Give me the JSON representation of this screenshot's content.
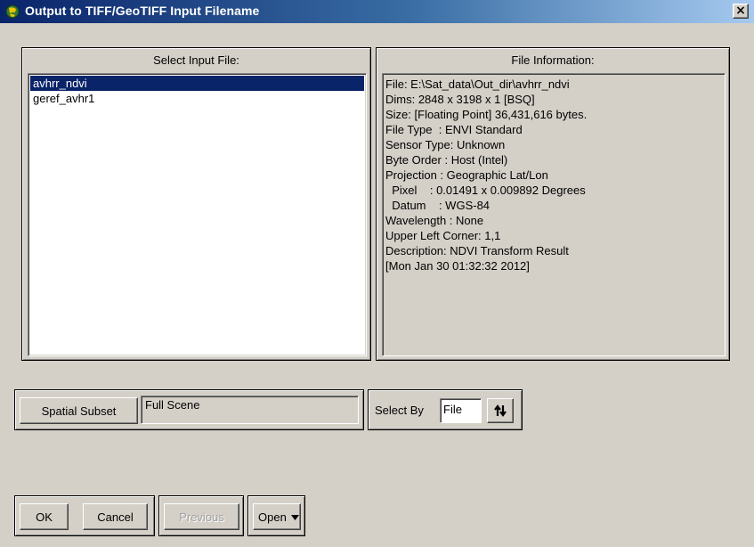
{
  "window": {
    "title": "Output to TIFF/GeoTIFF Input Filename",
    "close_label": "×"
  },
  "input_panel": {
    "label": "Select Input File:",
    "files": [
      {
        "name": "avhrr_ndvi",
        "selected": true
      },
      {
        "name": "geref_avhr1",
        "selected": false
      }
    ]
  },
  "info_panel": {
    "label": "File Information:",
    "lines": [
      "File: E:\\Sat_data\\Out_dir\\avhrr_ndvi",
      "Dims: 2848 x 3198 x 1 [BSQ]",
      "Size: [Floating Point] 36,431,616 bytes.",
      "File Type  : ENVI Standard",
      "Sensor Type: Unknown",
      "Byte Order : Host (Intel)",
      "Projection : Geographic Lat/Lon",
      "  Pixel    : 0.01491 x 0.009892 Degrees",
      "  Datum    : WGS-84",
      "Wavelength : None",
      "Upper Left Corner: 1,1",
      "Description: NDVI Transform Result",
      "[Mon Jan 30 01:32:32 2012]"
    ]
  },
  "subset": {
    "button_label": "Spatial Subset",
    "value": "Full Scene"
  },
  "select_by": {
    "label": "Select By",
    "value": "File",
    "sort_icon": "sort-arrows-icon"
  },
  "buttons": {
    "ok": "OK",
    "cancel": "Cancel",
    "previous": "Previous",
    "open": "Open"
  },
  "colors": {
    "title_bar": "#0a246a",
    "selection": "#0a246a",
    "face": "#d4d0c8"
  }
}
